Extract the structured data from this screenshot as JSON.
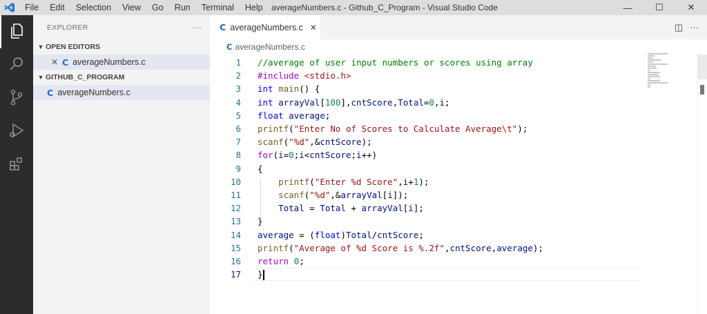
{
  "titlebar": {
    "menu": [
      "File",
      "Edit",
      "Selection",
      "View",
      "Go",
      "Run",
      "Terminal",
      "Help"
    ],
    "window_title": "averageNumbers.c - Github_C_Program - Visual Studio Code",
    "minimize": "—",
    "maximize": "☐",
    "close": "✕"
  },
  "activitybar": {
    "items": [
      {
        "icon": "files-icon",
        "active": true
      },
      {
        "icon": "search-icon"
      },
      {
        "icon": "source-control-icon"
      },
      {
        "icon": "run-debug-icon"
      },
      {
        "icon": "extensions-icon"
      }
    ]
  },
  "sidebar": {
    "title": "EXPLORER",
    "more": "···",
    "open_editors_label": "OPEN EDITORS",
    "open_editors": [
      {
        "close": "✕",
        "lang": "C",
        "name": "averageNumbers.c"
      }
    ],
    "folder_label": "GITHUB_C_PROGRAM",
    "files": [
      {
        "lang": "C",
        "name": "averageNumbers.c"
      }
    ]
  },
  "editor": {
    "tab": {
      "lang": "C",
      "name": "averageNumbers.c",
      "close": "✕"
    },
    "tab_actions": {
      "split": "◫",
      "more": "···"
    },
    "breadcrumb": {
      "lang": "C",
      "name": "averageNumbers.c"
    },
    "current_line": 17,
    "lines": [
      [
        [
          "//average of user input numbers or scores using array",
          "com"
        ]
      ],
      [
        [
          "#include ",
          "pre"
        ],
        [
          "<stdio.h>",
          "str"
        ]
      ],
      [
        [
          "int",
          "type"
        ],
        [
          " ",
          ""
        ],
        [
          "main",
          "fn"
        ],
        [
          "() {",
          ""
        ]
      ],
      [
        [
          "int",
          "type"
        ],
        [
          " ",
          ""
        ],
        [
          "arrayVal",
          "var"
        ],
        [
          "[",
          ""
        ],
        [
          "100",
          "num"
        ],
        [
          "],",
          ""
        ],
        [
          "cntScore",
          "var"
        ],
        [
          ",",
          ""
        ],
        [
          "Total",
          "var"
        ],
        [
          "=",
          ""
        ],
        [
          "0",
          "num"
        ],
        [
          ",",
          ""
        ],
        [
          "i",
          "var"
        ],
        [
          ";",
          ""
        ]
      ],
      [
        [
          "float",
          "type"
        ],
        [
          " ",
          ""
        ],
        [
          "average",
          "var"
        ],
        [
          ";",
          ""
        ]
      ],
      [
        [
          "printf",
          "fn"
        ],
        [
          "(",
          ""
        ],
        [
          "\"Enter No of Scores to Calculate Average",
          "str"
        ],
        [
          "\\t",
          "esc"
        ],
        [
          "\"",
          "str"
        ],
        [
          ");",
          ""
        ]
      ],
      [
        [
          "scanf",
          "fn"
        ],
        [
          "(",
          ""
        ],
        [
          "\"%d\"",
          "str"
        ],
        [
          ",&",
          ""
        ],
        [
          "cntScore",
          "var"
        ],
        [
          ");",
          ""
        ]
      ],
      [
        [
          "for",
          "ctl"
        ],
        [
          "(",
          ""
        ],
        [
          "i",
          "var"
        ],
        [
          "=",
          ""
        ],
        [
          "0",
          "num"
        ],
        [
          ";",
          ""
        ],
        [
          "i",
          "var"
        ],
        [
          "<",
          ""
        ],
        [
          "cntScore",
          "var"
        ],
        [
          ";",
          ""
        ],
        [
          "i",
          "var"
        ],
        [
          "++)",
          ""
        ]
      ],
      [
        [
          "{",
          ""
        ]
      ],
      [
        [
          "    ",
          ""
        ],
        [
          "printf",
          "fn"
        ],
        [
          "(",
          ""
        ],
        [
          "\"Enter %d Score\"",
          "str"
        ],
        [
          ",",
          ""
        ],
        [
          "i",
          "var"
        ],
        [
          "+",
          ""
        ],
        [
          "1",
          "num"
        ],
        [
          ");",
          ""
        ]
      ],
      [
        [
          "    ",
          ""
        ],
        [
          "scanf",
          "fn"
        ],
        [
          "(",
          ""
        ],
        [
          "\"%d\"",
          "str"
        ],
        [
          ",&",
          ""
        ],
        [
          "arrayVal",
          "var"
        ],
        [
          "[",
          ""
        ],
        [
          "i",
          "var"
        ],
        [
          "]);",
          ""
        ]
      ],
      [
        [
          "    ",
          ""
        ],
        [
          "Total",
          "var"
        ],
        [
          " = ",
          ""
        ],
        [
          "Total",
          "var"
        ],
        [
          " + ",
          ""
        ],
        [
          "arrayVal",
          "var"
        ],
        [
          "[",
          ""
        ],
        [
          "i",
          "var"
        ],
        [
          "];",
          ""
        ]
      ],
      [
        [
          "}",
          ""
        ]
      ],
      [
        [
          "average",
          "var"
        ],
        [
          " = (",
          ""
        ],
        [
          "float",
          "type"
        ],
        [
          ")",
          ""
        ],
        [
          "Total",
          "var"
        ],
        [
          "/",
          ""
        ],
        [
          "cntScore",
          "var"
        ],
        [
          ";",
          ""
        ]
      ],
      [
        [
          "printf",
          "fn"
        ],
        [
          "(",
          ""
        ],
        [
          "\"Average of %d Score is %.2f\"",
          "str"
        ],
        [
          ",",
          ""
        ],
        [
          "cntScore",
          "var"
        ],
        [
          ",",
          ""
        ],
        [
          "average",
          "var"
        ],
        [
          ");",
          ""
        ]
      ],
      [
        [
          "return",
          "ctl"
        ],
        [
          " ",
          ""
        ],
        [
          "0",
          "num"
        ],
        [
          ";",
          ""
        ]
      ],
      [
        [
          "}",
          ""
        ]
      ]
    ]
  }
}
